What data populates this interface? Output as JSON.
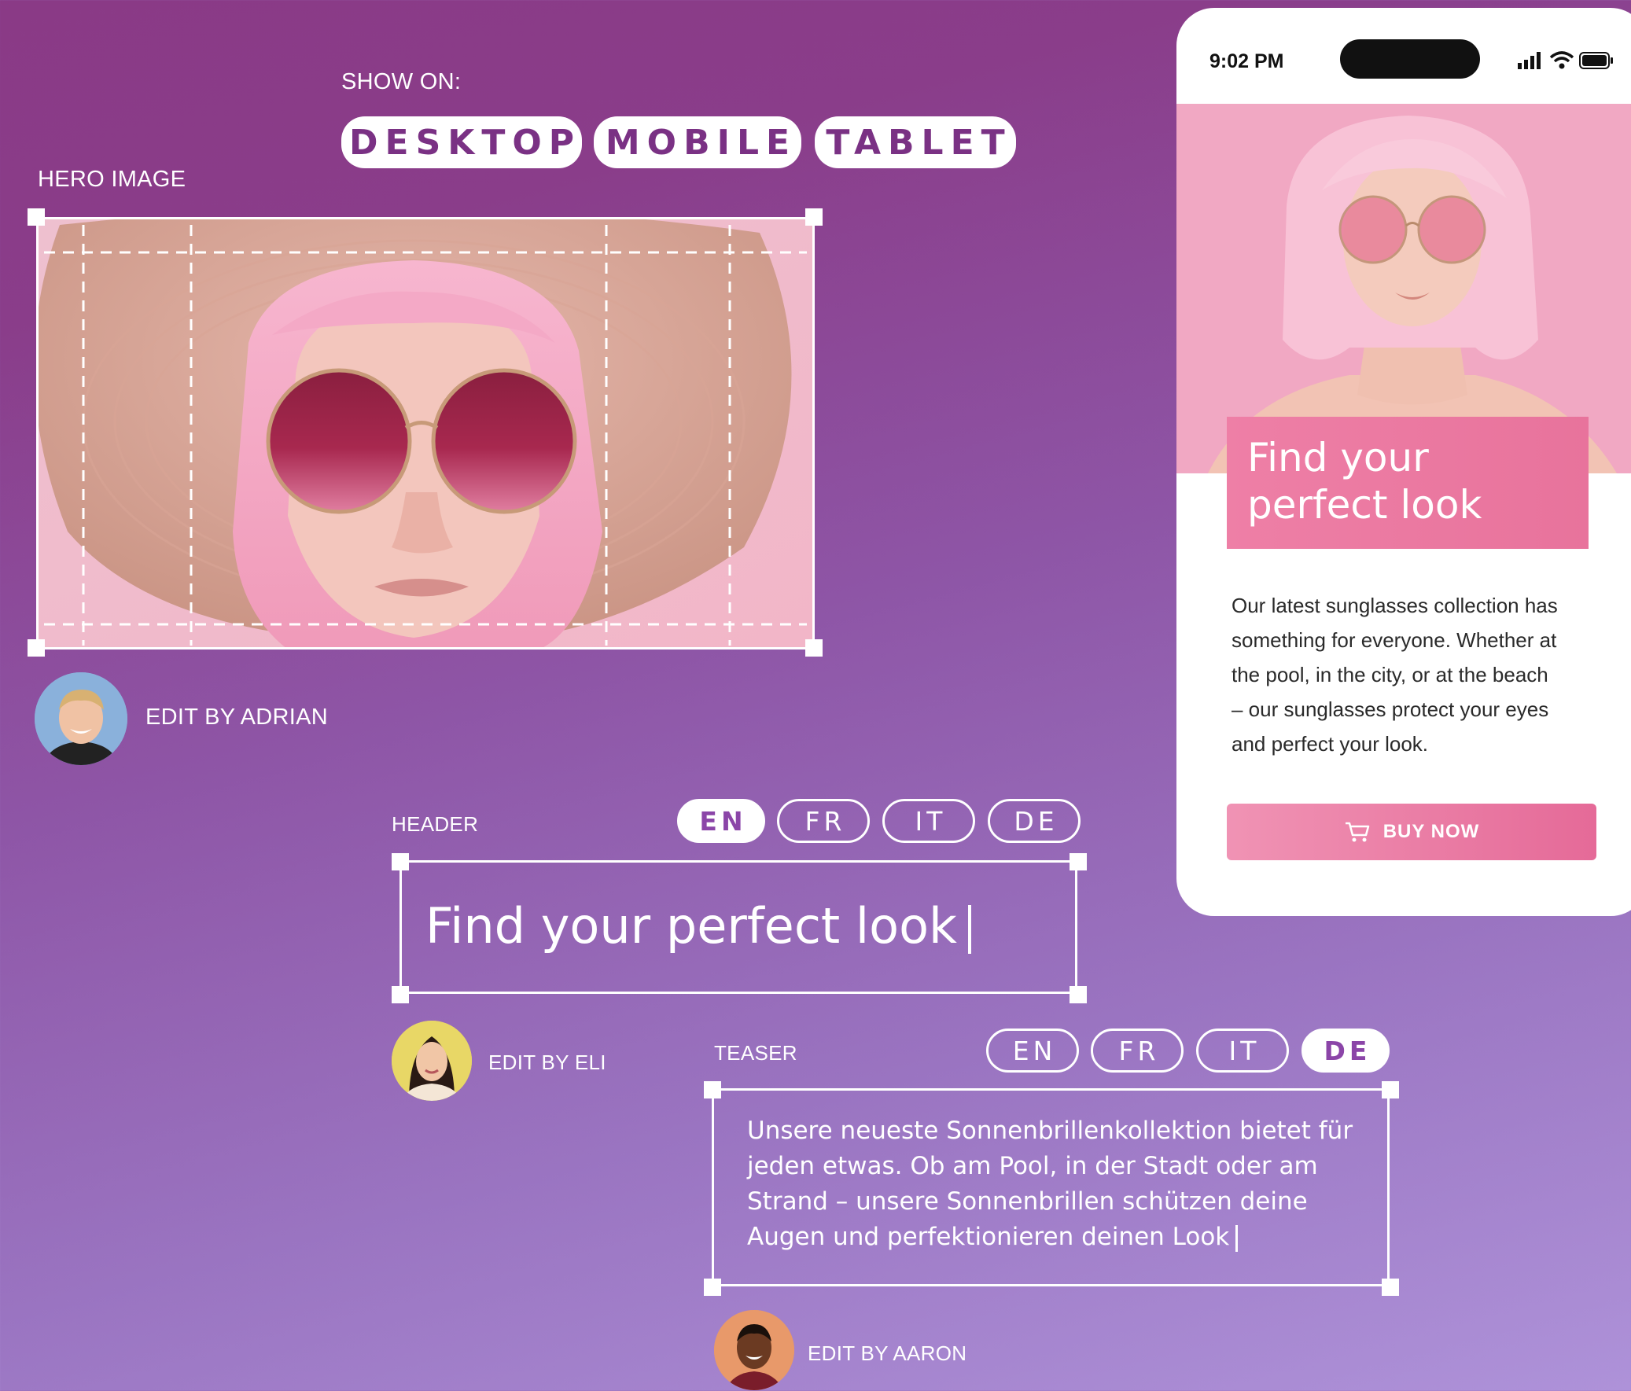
{
  "show_on": {
    "label": "SHOW ON:",
    "options": [
      "DESKTOP",
      "MOBILE",
      "TABLET"
    ]
  },
  "hero": {
    "label": "HERO IMAGE",
    "editor_label": "EDIT BY ADRIAN"
  },
  "header_field": {
    "label": "HEADER",
    "languages": [
      "EN",
      "FR",
      "IT",
      "DE"
    ],
    "active_language": "EN",
    "value": "Find your perfect look",
    "editor_label": "EDIT BY ELI"
  },
  "teaser_field": {
    "label": "TEASER",
    "languages": [
      "EN",
      "FR",
      "IT",
      "DE"
    ],
    "active_language": "DE",
    "lines": [
      "Unsere neueste Sonnenbrillenkollektion bietet für",
      "jeden etwas. Ob am Pool, in der Stadt oder am",
      "Strand – unsere Sonnenbrillen schützen deine",
      "Augen und perfektionieren deinen Look"
    ],
    "editor_label": "EDIT BY AARON"
  },
  "phone": {
    "time": "9:02 PM",
    "headline_lines": [
      "Find your",
      "perfect look"
    ],
    "body_lines": [
      "Our latest sunglasses collection has",
      "something for everyone. Whether at",
      "the pool, in the city, or at the beach",
      "– our sunglasses protect your eyes",
      "and perfect your look."
    ],
    "cta_label": "BUY NOW",
    "cta_icon": "cart-icon",
    "status_icons": [
      "signal-icon",
      "wifi-icon",
      "battery-icon"
    ]
  },
  "colors": {
    "brand_purple": "#7a3184",
    "brand_pink": "#ee7fa6",
    "hero_pink": "#f3aac5"
  }
}
